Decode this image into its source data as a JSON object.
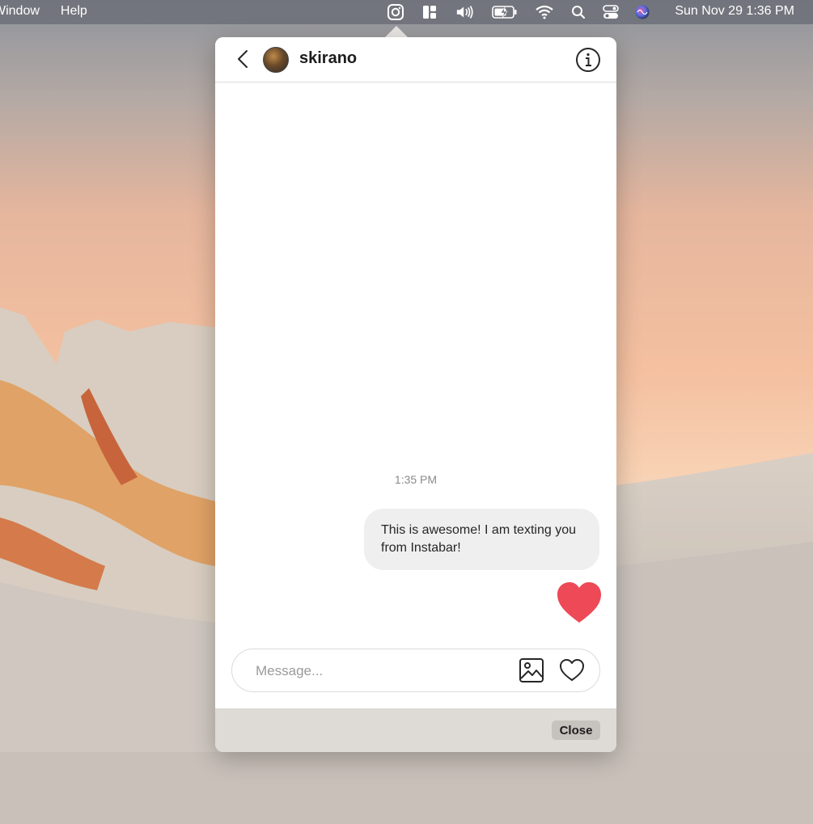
{
  "menubar": {
    "menus": [
      "Window",
      "Help"
    ],
    "clock": "Sun Nov 29  1:36 PM",
    "icons": [
      "instagram-icon",
      "layout-icon",
      "volume-icon",
      "battery-charging-icon",
      "wifi-icon",
      "search-icon",
      "control-center-icon",
      "siri-icon"
    ]
  },
  "chat": {
    "username": "skirano",
    "timestamp": "1:35 PM",
    "messages": [
      {
        "from": "me",
        "text": "This is awesome! I am texting you from Instabar!"
      },
      {
        "from": "me",
        "type": "like"
      }
    ],
    "like_color": "#ed4956"
  },
  "composer": {
    "placeholder": "Message...",
    "value": ""
  },
  "footer": {
    "close_label": "Close"
  }
}
